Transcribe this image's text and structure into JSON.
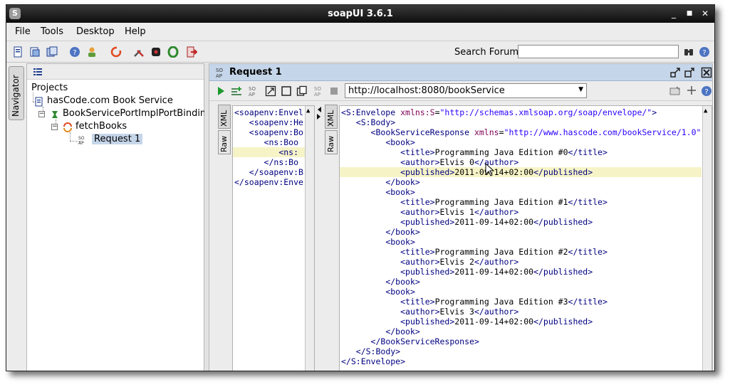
{
  "window": {
    "title": "soapUI 3.6.1",
    "controls": [
      "_",
      "■",
      "✕"
    ]
  },
  "menu": [
    "File",
    "Tools",
    "Desktop",
    "Help"
  ],
  "toolbar": {
    "search_label": "Search Forum",
    "search_value": ""
  },
  "navigator": {
    "tab_label": "Navigator",
    "tree": [
      {
        "label": "Projects",
        "depth": 0
      },
      {
        "label": "hasCode.com Book Service",
        "depth": 1
      },
      {
        "label": "BookServicePortImplPortBinding",
        "depth": 2
      },
      {
        "label": "fetchBooks",
        "depth": 3
      },
      {
        "label": "Request 1",
        "depth": 4,
        "selected": true
      }
    ]
  },
  "editor": {
    "title": "Request 1",
    "endpoint": "http://localhost:8080/bookService",
    "request_tabs": [
      "XML",
      "Raw"
    ],
    "response_tabs": [
      "XML",
      "Raw"
    ],
    "request_lines": [
      "<soapenv:Envel",
      "   <soapenv:He",
      "   <soapenv:Bo",
      "      <ns:Boo",
      "         <ns:",
      "      </ns:Bo",
      "   </soapenv:B",
      "</soapenv:Enve"
    ],
    "response_lines": [
      "<S:Envelope xmlns:S=\"http://schemas.xmlsoap.org/soap/envelope/\">",
      "   <S:Body>",
      "      <BookServiceResponse xmlns=\"http://www.hascode.com/bookService/1.0\"",
      "         <book>",
      "            <title>Programming Java Edition #0</title>",
      "            <author>Elvis 0</author>",
      "            <published>2011-09-14+02:00</published>",
      "         </book>",
      "         <book>",
      "            <title>Programming Java Edition #1</title>",
      "            <author>Elvis 1</author>",
      "            <published>2011-09-14+02:00</published>",
      "         </book>",
      "         <book>",
      "            <title>Programming Java Edition #2</title>",
      "            <author>Elvis 2</author>",
      "            <published>2011-09-14+02:00</published>",
      "         </book>",
      "         <book>",
      "            <title>Programming Java Edition #3</title>",
      "            <author>Elvis 3</author>",
      "            <published>2011-09-14+02:00</published>",
      "         </book>",
      "      </BookServiceResponse>",
      "   </S:Body>",
      "</S:Envelope>"
    ]
  },
  "colors": {
    "header_bg": "#c6d6ea",
    "selection_bg": "#c6d6ea",
    "highlight_line": "#f6f4c6",
    "tag": "#000080",
    "attr": "#7f0055",
    "value": "#2a00ff"
  }
}
